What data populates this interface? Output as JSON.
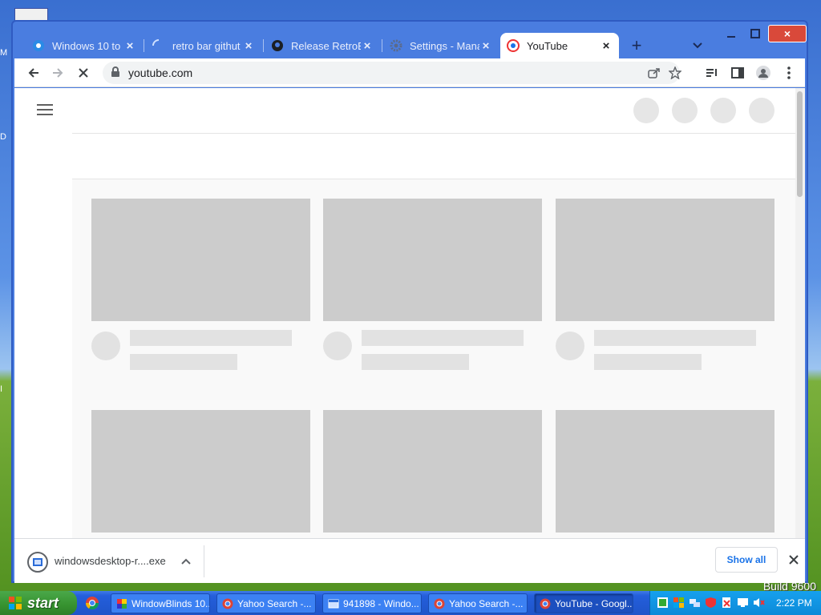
{
  "desktop": {
    "build_text": "Build 9600",
    "left_glyphs": [
      "M",
      "D",
      "I"
    ]
  },
  "browser": {
    "tabs": [
      {
        "title": "Windows 10 to",
        "icon": "edge-icon"
      },
      {
        "title": "retro bar githut",
        "icon": "loading-icon"
      },
      {
        "title": "Release RetroBa",
        "icon": "github-icon"
      },
      {
        "title": "Settings - Mana",
        "icon": "gear-icon"
      },
      {
        "title": "YouTube",
        "icon": "youtube-icon",
        "active": true
      }
    ],
    "url": "youtube.com"
  },
  "download": {
    "filename": "windowsdesktop-r....exe",
    "show_all": "Show all"
  },
  "taskbar": {
    "start_label": "start",
    "tasks": [
      {
        "label": "WindowBlinds 10....",
        "icon": "windowblinds-icon"
      },
      {
        "label": "Yahoo Search -...",
        "icon": "chrome-icon"
      },
      {
        "label": "941898 - Windo...",
        "icon": "explorer-icon"
      },
      {
        "label": "Yahoo Search -...",
        "icon": "chrome-icon"
      },
      {
        "label": "YouTube - Googl...",
        "icon": "chrome-icon",
        "active": true
      }
    ],
    "clock": "2:22 PM"
  },
  "colors": {
    "title_blue": "#4a7de0",
    "close_red": "#d9493a",
    "skeleton": "#cccccc",
    "xp_green": "#36922f"
  }
}
